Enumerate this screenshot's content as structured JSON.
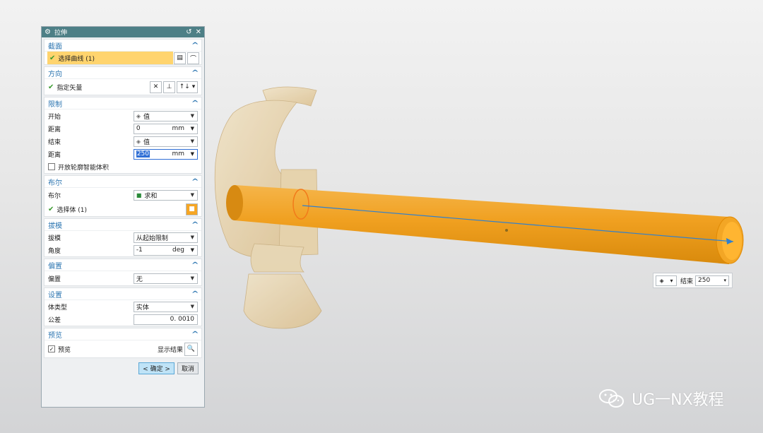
{
  "dialog": {
    "title": "拉伸",
    "sections": {
      "section": {
        "title": "截面",
        "select_curve": "选择曲线 (1)"
      },
      "direction": {
        "title": "方向",
        "specify_vector": "指定矢量"
      },
      "limits": {
        "title": "限制",
        "start_label": "开始",
        "start_value": "值",
        "start_dist_label": "距离",
        "start_dist": "0",
        "start_unit": "mm",
        "end_label": "结束",
        "end_value": "值",
        "end_dist_label": "距离",
        "end_dist": "250",
        "end_unit": "mm",
        "open_profile": "开放轮廓智能体积"
      },
      "boolean": {
        "title": "布尔",
        "label": "布尔",
        "value": "求和",
        "select_body": "选择体 (1)"
      },
      "draft": {
        "title": "拔模",
        "label": "拔模",
        "value": "从起始限制",
        "angle_label": "角度",
        "angle": "-1",
        "angle_unit": "deg"
      },
      "offset": {
        "title": "偏置",
        "label": "偏置",
        "value": "无"
      },
      "settings": {
        "title": "设置",
        "body_type_label": "体类型",
        "body_type": "实体",
        "tolerance_label": "公差",
        "tolerance": "0. 0010"
      },
      "preview": {
        "title": "预览",
        "preview_label": "预览",
        "show_result": "显示结果"
      }
    },
    "buttons": {
      "ok": "< 确定 >",
      "cancel": "取消"
    }
  },
  "onscreen_input": {
    "label": "结束",
    "value": "250"
  },
  "watermark": {
    "text": "UG一NX教程"
  },
  "colors": {
    "titlebar": "#4d7f86",
    "accent": "#2f77b2",
    "selection": "#ffd46e",
    "model_orange": "#f2a21e",
    "model_tan": "#e9d3a8"
  }
}
